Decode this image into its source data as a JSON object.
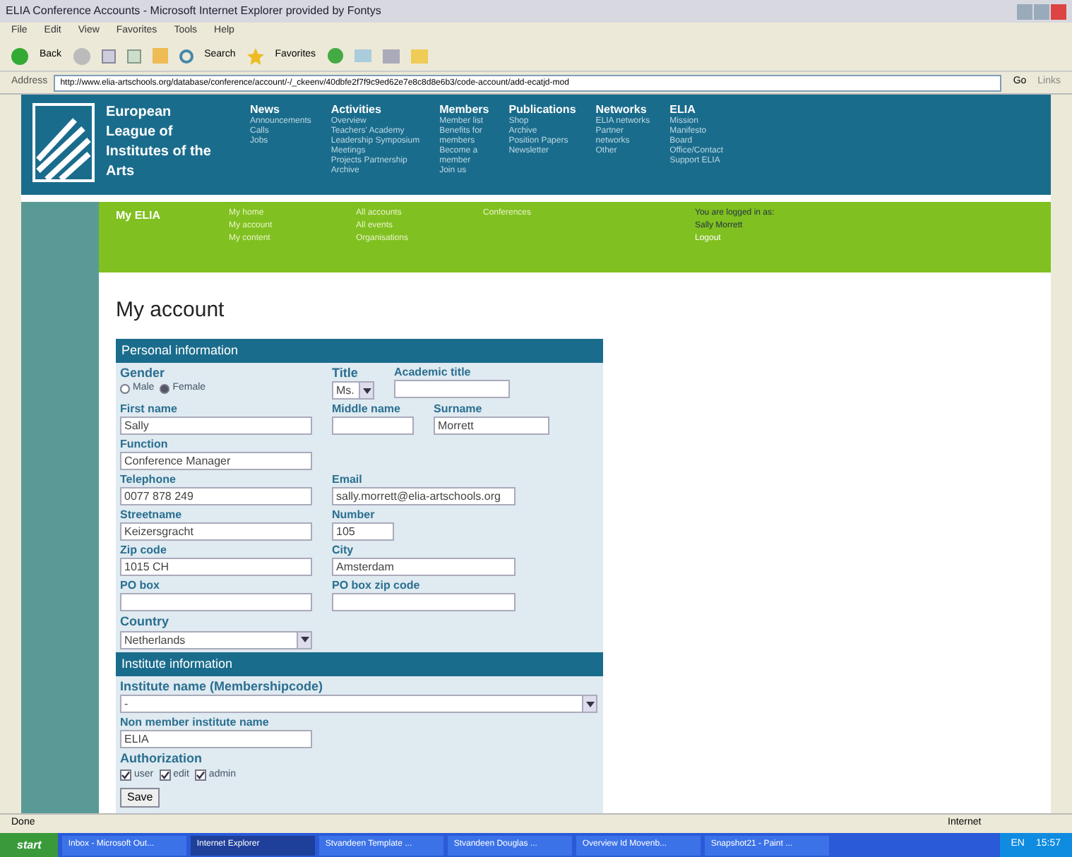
{
  "window": {
    "title": "ELIA Conference Accounts - Microsoft Internet Explorer provided by Fontys"
  },
  "menu": [
    "File",
    "Edit",
    "View",
    "Favorites",
    "Tools",
    "Help"
  ],
  "toolbar": {
    "back": "Back",
    "search": "Search",
    "favorites": "Favorites"
  },
  "address": {
    "label": "Address",
    "url": "http://www.elia-artschools.org/database/conference/account/-/_ckeenv/40dbfe2f7f9c9ed62e7e8c8d8e6b3/code-account/add-ecatjd-mod",
    "go": "Go",
    "links": "Links"
  },
  "site": {
    "logo_text": "European League of Institutes of the Arts",
    "nav": [
      {
        "heading": "News",
        "items": [
          "Announcements",
          "Calls",
          "Jobs"
        ]
      },
      {
        "heading": "Activities",
        "items": [
          "Overview",
          "Teachers' Academy",
          "Leadership Symposium",
          "Meetings",
          "Projects Partnership",
          "Archive"
        ]
      },
      {
        "heading": "Members",
        "items": [
          "Member list",
          "Benefits for",
          "members",
          "Become a",
          "member",
          "Join us"
        ]
      },
      {
        "heading": "Publications",
        "items": [
          "Shop",
          "Archive",
          "Position Papers",
          "Newsletter"
        ]
      },
      {
        "heading": "Networks",
        "items": [
          "ELIA networks",
          "Partner",
          "networks",
          "Other"
        ]
      },
      {
        "heading": "ELIA",
        "items": [
          "Mission",
          "Manifesto",
          "Board",
          "Office/Contact",
          "Support ELIA"
        ]
      }
    ],
    "subnav": {
      "title": "My ELIA",
      "columns": [
        [
          "My home",
          "My account",
          "My content"
        ],
        [
          "All accounts",
          "All events",
          "Organisations"
        ],
        [
          "Conferences"
        ]
      ]
    },
    "login": {
      "text": "You are logged in as:",
      "user": "Sally Morrett",
      "logout": "Logout"
    }
  },
  "page_title": "My account",
  "personal": {
    "heading": "Personal information",
    "gender": {
      "label": "Gender",
      "options": [
        {
          "label": "Male",
          "selected": false
        },
        {
          "label": "Female",
          "selected": true
        }
      ]
    },
    "title": {
      "label": "Title",
      "value": "Ms."
    },
    "academic": {
      "label": "Academic title"
    },
    "first_name": {
      "label": "First name",
      "value": "Sally"
    },
    "middle_name": {
      "label": "Middle name"
    },
    "surname": {
      "label": "Surname",
      "value": "Morrett"
    },
    "function": {
      "label": "Function",
      "value": "Conference Manager"
    },
    "telephone": {
      "label": "Telephone",
      "value": "0077 878 249"
    },
    "email": {
      "label": "Email",
      "value": "sally.morrett@elia-artschools.org"
    },
    "street": {
      "label": "Streetname",
      "value": "Keizersgracht"
    },
    "number": {
      "label": "Number",
      "value": "105"
    },
    "zip": {
      "label": "Zip code",
      "value": "1015 CH"
    },
    "city": {
      "label": "City",
      "value": "Amsterdam"
    },
    "po_box": {
      "label": "PO box"
    },
    "po_zip": {
      "label": "PO box zip code"
    },
    "country": {
      "label": "Country",
      "value": "Netherlands"
    }
  },
  "institute": {
    "heading": "Institute information",
    "name": {
      "label": "Institute name (Membershipcode)",
      "value": "-"
    },
    "non_member": {
      "label": "Non member institute name",
      "value": "ELIA"
    },
    "authorization": {
      "label": "Authorization",
      "options": [
        {
          "label": "user",
          "checked": true
        },
        {
          "label": "edit",
          "checked": true
        },
        {
          "label": "admin",
          "checked": true
        }
      ]
    },
    "save": "Save"
  },
  "status_bar": {
    "status": "Done",
    "zone": "Internet"
  },
  "taskbar": {
    "start": "start",
    "tasks": [
      {
        "label": "Inbox - Microsoft Out...",
        "selected": false
      },
      {
        "label": "Internet Explorer",
        "selected": true
      },
      {
        "label": "Stvandeen Template ...",
        "selected": false
      },
      {
        "label": "Stvandeen Douglas ...",
        "selected": false
      },
      {
        "label": "Overview Id Movenb...",
        "selected": false
      },
      {
        "label": "Snapshot21 - Paint ...",
        "selected": false
      }
    ],
    "lang": "EN",
    "time": "15:57"
  }
}
